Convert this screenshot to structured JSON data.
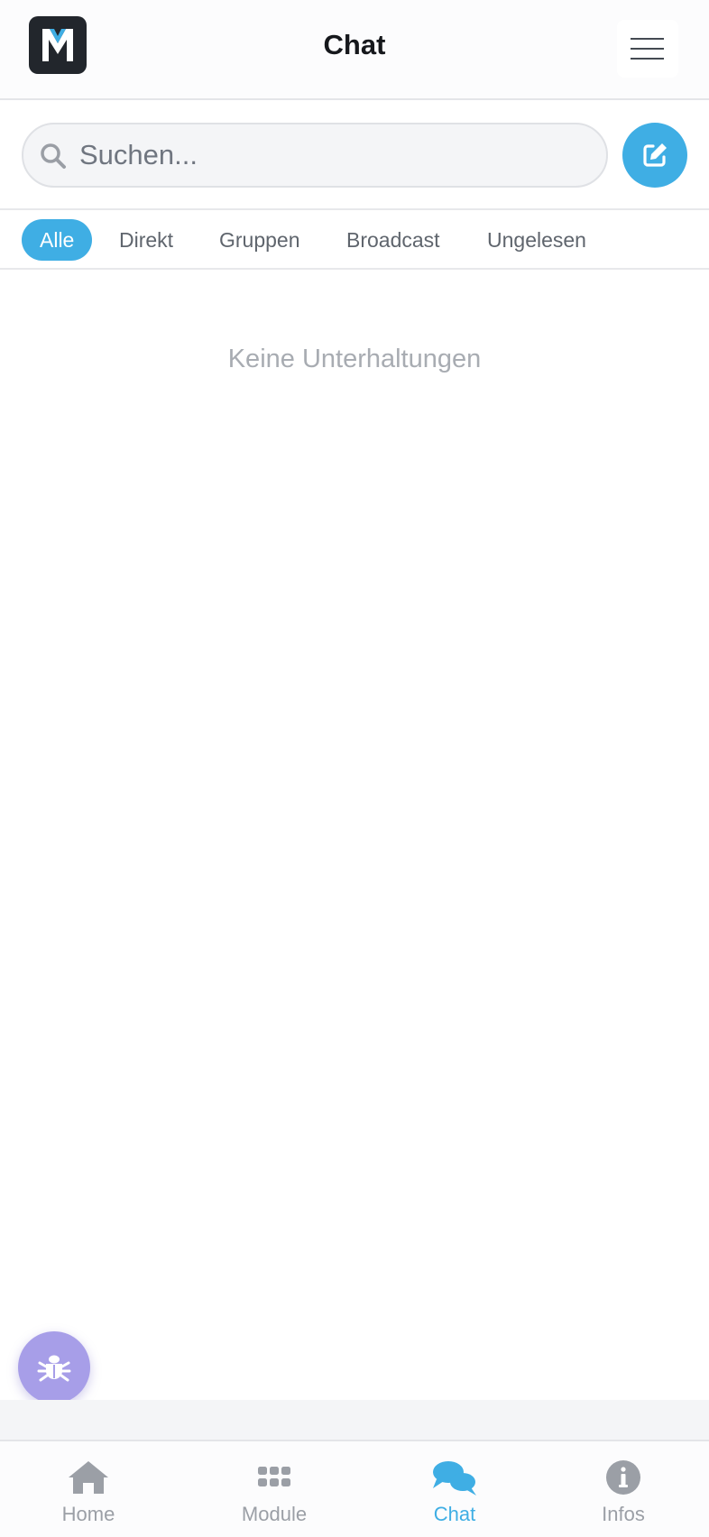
{
  "header": {
    "title": "Chat",
    "logo_letter": "M"
  },
  "search": {
    "placeholder": "Suchen..."
  },
  "filters": [
    {
      "label": "Alle",
      "active": true
    },
    {
      "label": "Direkt",
      "active": false
    },
    {
      "label": "Gruppen",
      "active": false
    },
    {
      "label": "Broadcast",
      "active": false
    },
    {
      "label": "Ungelesen",
      "active": false
    }
  ],
  "empty_state": "Keine Unterhaltungen",
  "bottom_nav": [
    {
      "label": "Home",
      "icon": "home-icon",
      "active": false
    },
    {
      "label": "Module",
      "icon": "grid-icon",
      "active": false
    },
    {
      "label": "Chat",
      "icon": "chat-bubbles-icon",
      "active": true
    },
    {
      "label": "Infos",
      "icon": "info-icon",
      "active": false
    }
  ],
  "colors": {
    "accent": "#3faee4",
    "debug": "#a79ee8",
    "logo_bg": "#22262c"
  }
}
